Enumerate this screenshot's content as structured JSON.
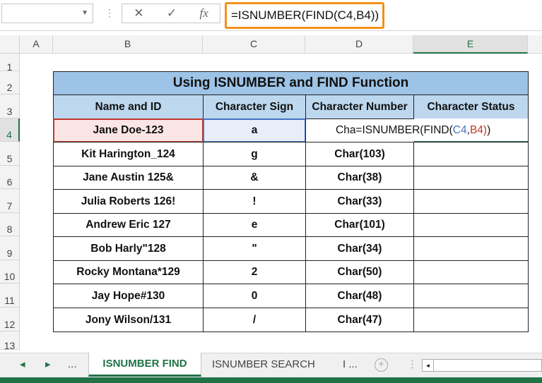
{
  "formula_bar": {
    "name_box": "",
    "cancel_icon": "✕",
    "enter_icon": "✓",
    "fx_label": "fx",
    "formula": "=ISNUMBER(FIND(C4,B4))"
  },
  "columns": [
    "A",
    "B",
    "C",
    "D",
    "E"
  ],
  "rows": [
    "1",
    "2",
    "3",
    "4",
    "5",
    "6",
    "7",
    "8",
    "9",
    "10",
    "11",
    "12",
    "13"
  ],
  "table": {
    "title": "Using ISNUMBER and FIND Function",
    "headers": [
      "Name and ID",
      "Character Sign",
      "Character Number",
      "Character Status"
    ],
    "rows": [
      [
        "Jane Doe-123",
        "a",
        "Cha=ISNUMBER(FIND(C4,B4))",
        ""
      ],
      [
        "Kit Harington_124",
        "g",
        "Char(103)",
        ""
      ],
      [
        "Jane Austin 125&",
        "&",
        "Char(38)",
        ""
      ],
      [
        "Julia Roberts 126!",
        "!",
        "Char(33)",
        ""
      ],
      [
        "Andrew Eric 127",
        "e",
        "Char(101)",
        ""
      ],
      [
        "Bob Harly\"128",
        "\"",
        "Char(34)",
        ""
      ],
      [
        "Rocky Montana*129",
        "2",
        "Char(50)",
        ""
      ],
      [
        "Jay Hope#130",
        "0",
        "Char(48)",
        ""
      ],
      [
        "Jony Wilson/131",
        "/",
        "Char(47)",
        ""
      ]
    ]
  },
  "edit": {
    "prefix": "Cha=ISNUMBER(FIND(",
    "ref1": "C4",
    "comma": ",",
    "ref2": "B4)",
    "suffix": ")"
  },
  "sheet_tabs": {
    "prev": "◂",
    "next": "▸",
    "more": "...",
    "active": "ISNUMBER FIND",
    "other": "ISNUMBER SEARCH",
    "truncated": "I ...",
    "add": "+"
  },
  "colors": {
    "accent": "#217346",
    "formula_highlight": "#f39019",
    "ref_c4": "#4472c4",
    "ref_b4": "#c0392b"
  }
}
